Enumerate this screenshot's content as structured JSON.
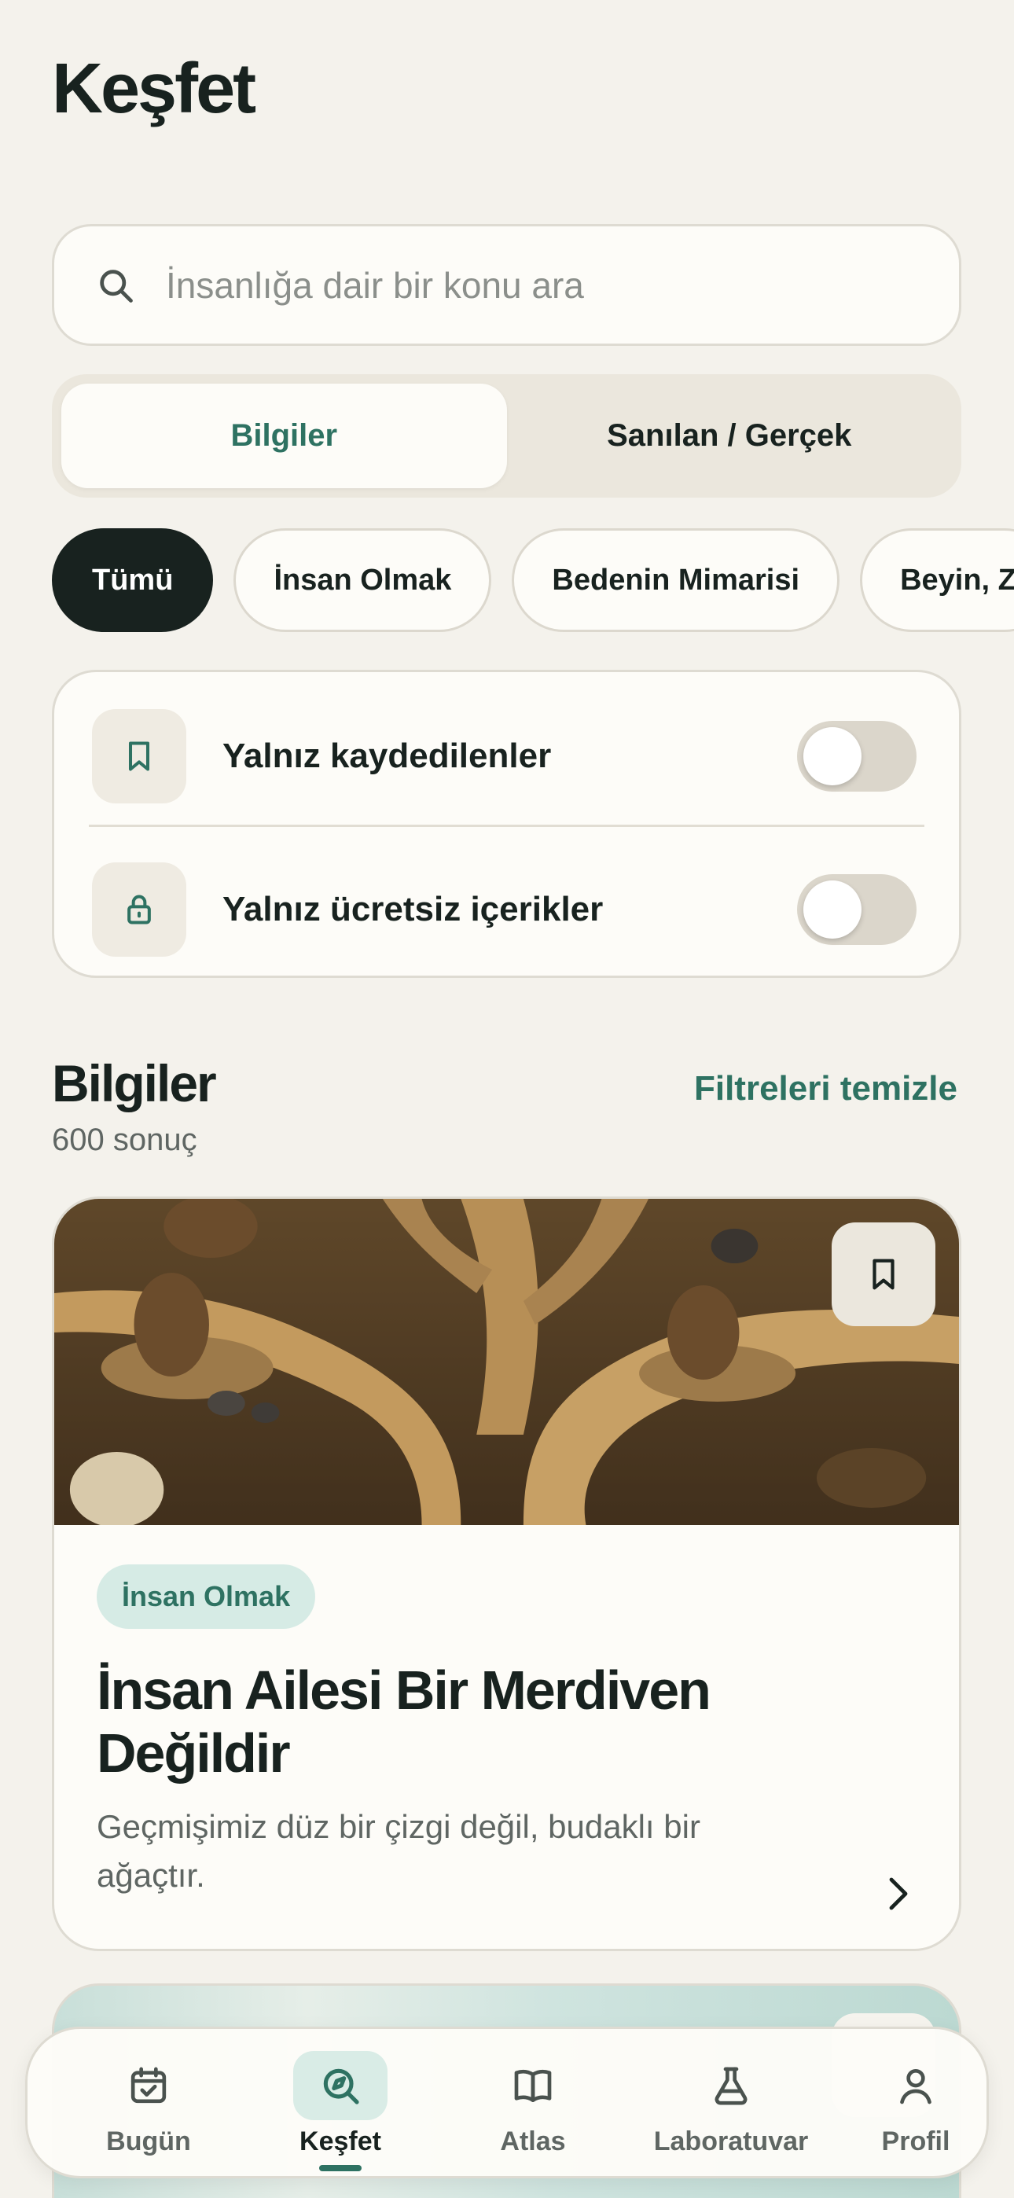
{
  "header": {
    "title": "Keşfet"
  },
  "search": {
    "placeholder": "İnsanlığa dair bir konu ara",
    "icon": "search-icon"
  },
  "segment": {
    "items": [
      {
        "label": "Bilgiler",
        "selected": true
      },
      {
        "label": "Sanılan / Gerçek",
        "selected": false
      }
    ]
  },
  "chips": {
    "items": [
      {
        "label": "Tümü",
        "selected": true
      },
      {
        "label": "İnsan Olmak"
      },
      {
        "label": "Bedenin Mimarisi"
      },
      {
        "label": "Beyin, Z"
      }
    ]
  },
  "filters": {
    "saved": {
      "label": "Yalnız kaydedilenler",
      "icon": "bookmark-icon",
      "on": false
    },
    "free": {
      "label": "Yalnız ücretsiz içerikler",
      "icon": "lock-icon",
      "on": false
    }
  },
  "results": {
    "title": "Bilgiler",
    "count": "600 sonuç",
    "clear": "Filtreleri temizle"
  },
  "card": {
    "tag": "İnsan Olmak",
    "title": "İnsan Ailesi Bir Merdiven Değildir",
    "description": "Geçmişimiz düz bir çizgi değil, budaklı bir ağaçtır.",
    "image": "hominid-figures-on-branching-path-image"
  },
  "tabbar": {
    "items": [
      {
        "label": "Bugün",
        "icon": "calendar-check-icon"
      },
      {
        "label": "Keşfet",
        "icon": "explore-search-icon",
        "active": true
      },
      {
        "label": "Atlas",
        "icon": "book-icon"
      },
      {
        "label": "Laboratuvar",
        "icon": "flask-icon"
      },
      {
        "label": "Profil",
        "icon": "user-icon"
      }
    ]
  },
  "colors": {
    "accent": "#2e7262",
    "background": "#f4f2ec",
    "surface": "#fdfcf8",
    "dark": "#18221f",
    "tagBackground": "#d6ebe5"
  }
}
